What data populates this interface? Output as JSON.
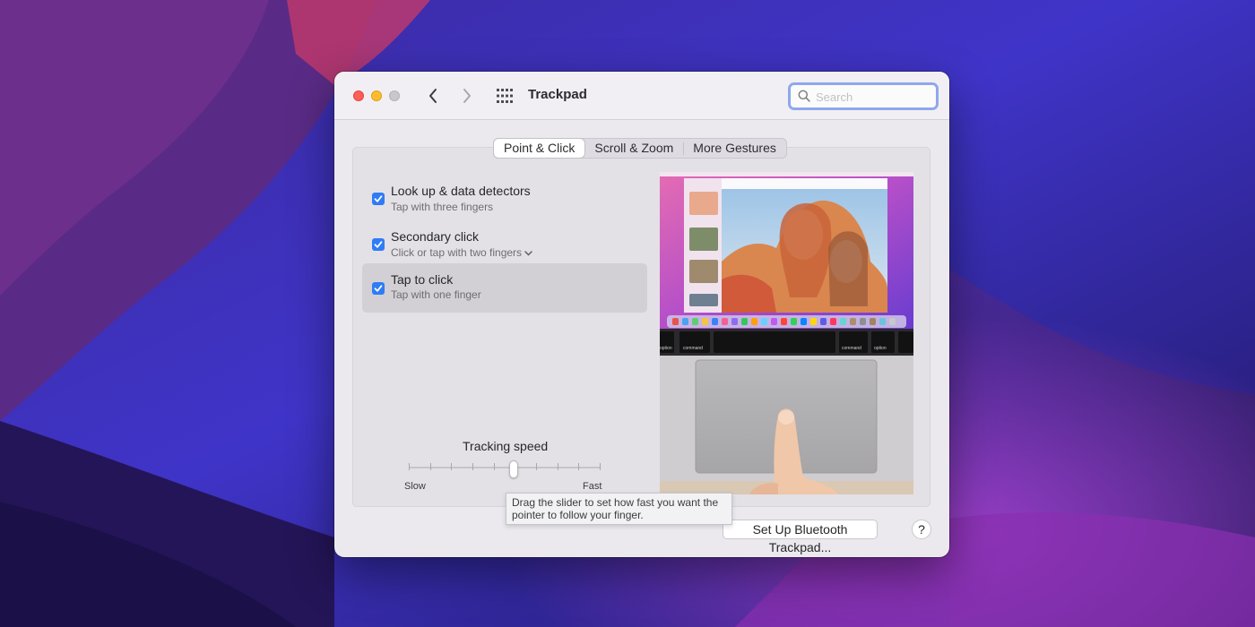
{
  "window": {
    "title": "Trackpad",
    "search_placeholder": "Search"
  },
  "tabs": [
    {
      "label": "Point & Click",
      "active": true
    },
    {
      "label": "Scroll & Zoom",
      "active": false
    },
    {
      "label": "More Gestures",
      "active": false
    }
  ],
  "options": [
    {
      "title": "Look up & data detectors",
      "subtitle": "Tap with three fingers",
      "checked": true,
      "selected": false
    },
    {
      "title": "Secondary click",
      "subtitle": "Click or tap with two fingers",
      "checked": true,
      "selected": false,
      "has_dropdown": true
    },
    {
      "title": "Tap to click",
      "subtitle": "Tap with one finger",
      "checked": true,
      "selected": true
    }
  ],
  "tracking": {
    "label": "Tracking speed",
    "min_label": "Slow",
    "max_label": "Fast",
    "position_fraction": 0.55,
    "tick_count": 10,
    "tooltip": "Drag the slider to set how fast you want the pointer to follow your finger."
  },
  "preview": {
    "keyboard_keys": [
      "option",
      "command",
      "command",
      "option"
    ]
  },
  "buttons": {
    "setup": "Set Up Bluetooth Trackpad...",
    "help": "?"
  },
  "colors": {
    "accent": "#2f7cf6",
    "close": "#fe5f57",
    "minimize": "#febc2e",
    "search_focus": "#8fa8ec"
  }
}
